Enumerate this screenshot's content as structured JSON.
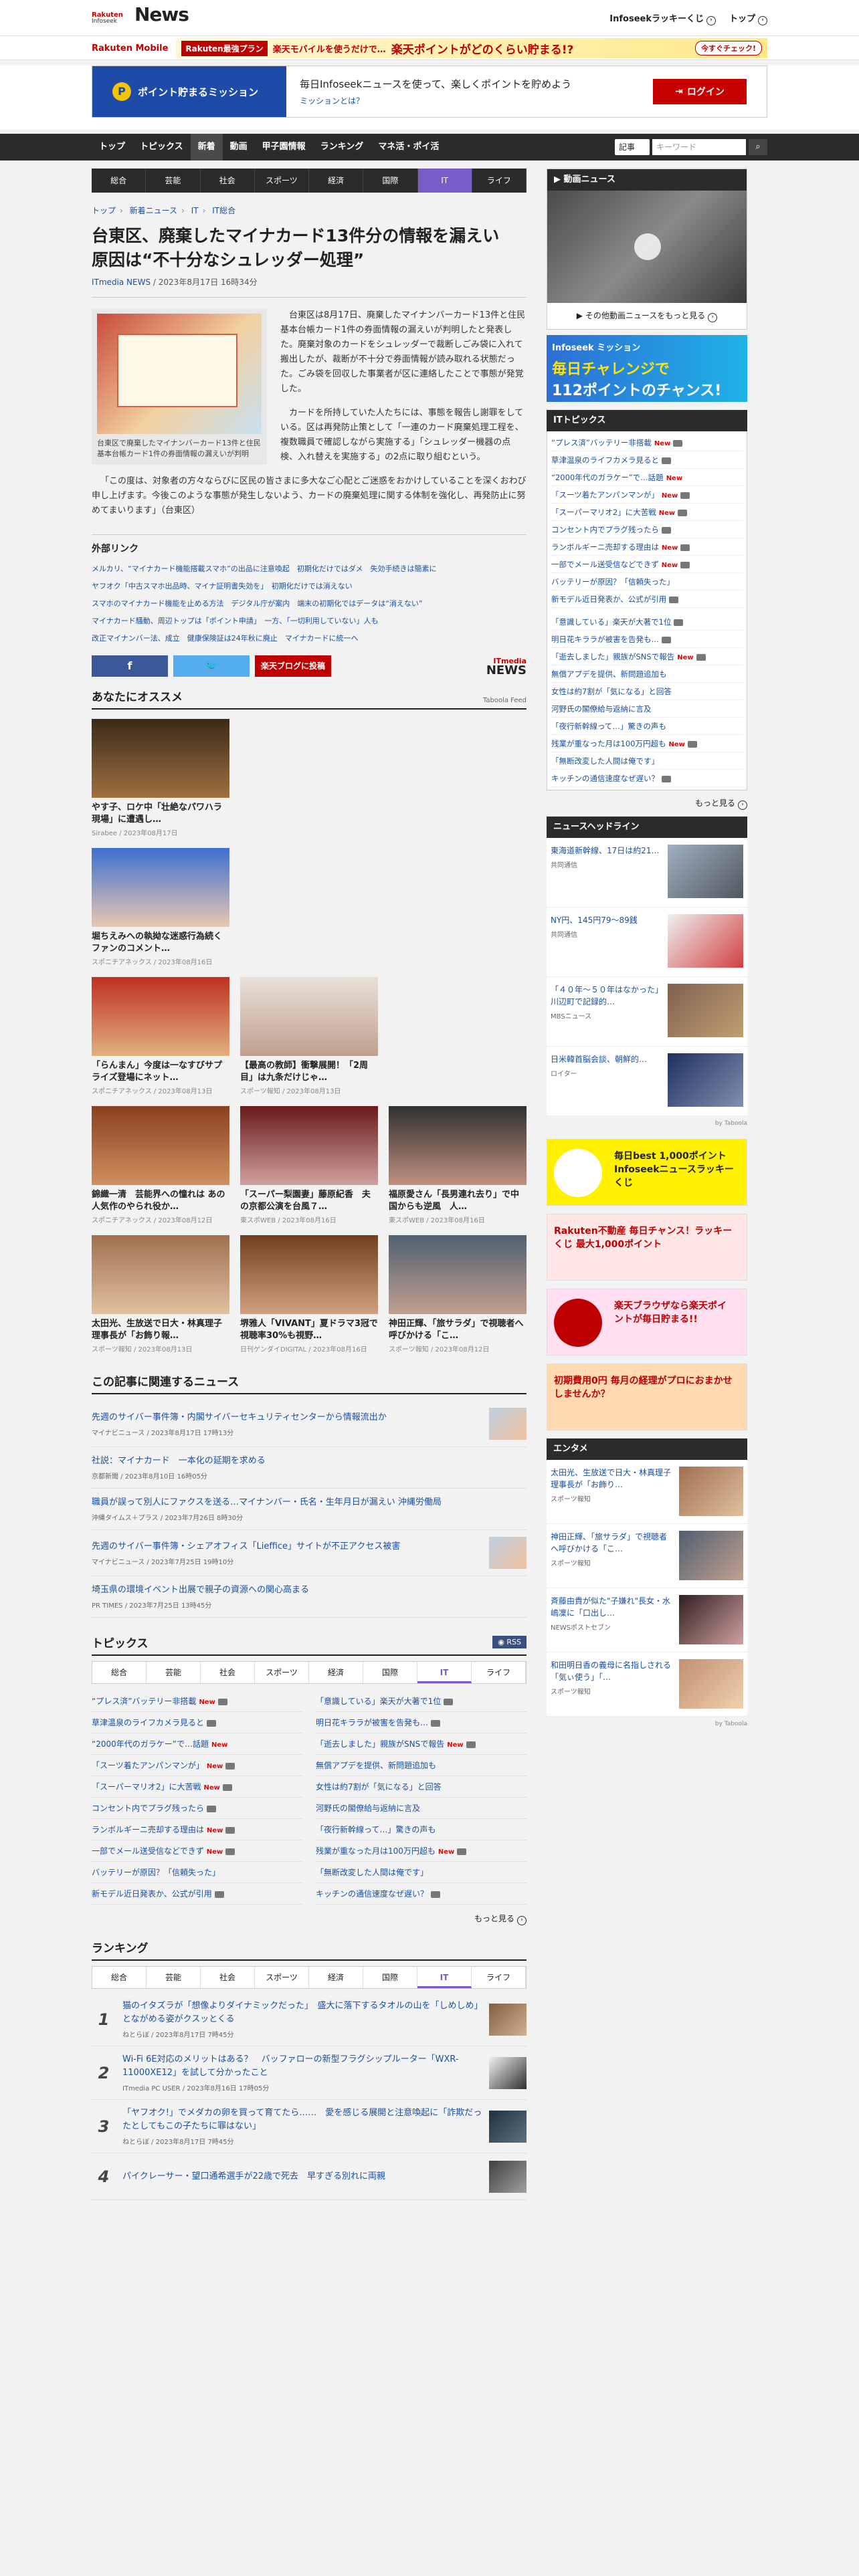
{
  "header": {
    "logo_top": "Rakuten",
    "logo_mid": "Infoseek",
    "logo_main": "News",
    "lucky_kuji": "Infoseekラッキーくじ",
    "top_link": "トップ"
  },
  "promo": {
    "mobile": "Rakuten Mobile",
    "tag": "Rakuten最強プラン",
    "text1": "楽天モバイルを使うだけで…",
    "text2": "楽天ポイントがどのくらい貯まる!?",
    "btn": "今すぐチェック!"
  },
  "mission": {
    "left": "ポイント貯まるミッション",
    "text": "毎日Infoseekニュースを使って、楽しくポイントを貯めよう",
    "sub": "ミッションとは？",
    "login": "ログイン"
  },
  "nav": {
    "items": [
      "トップ",
      "トピックス",
      "新着",
      "動画",
      "甲子園情報",
      "ランキング",
      "マネ活・ポイ活"
    ],
    "select": "記事",
    "search_placeholder": "キーワード"
  },
  "subnav": [
    "総合",
    "芸能",
    "社会",
    "スポーツ",
    "経済",
    "国際",
    "IT",
    "ライフ"
  ],
  "breadcrumb": [
    "トップ",
    "新着ニュース",
    "IT",
    "IT総合"
  ],
  "article": {
    "title": "台東区、廃棄したマイナカード13件分の情報を漏えい　原因は“不十分なシュレッダー処理”",
    "source": "ITmedia NEWS",
    "date": "2023年8月17日 16時34分",
    "caption": "台東区で廃棄したマイナンバーカード13件と住民基本台帳カード1件の券面情報の漏えいが判明",
    "p1": "台東区は8月17日、廃棄したマイナンバーカード13件と住民基本台帳カード1件の券面情報の漏えいが判明したと発表した。廃棄対象のカードをシュレッダーで裁断しごみ袋に入れて搬出したが、裁断が不十分で券面情報が読み取れる状態だった。ごみ袋を回収した事業者が区に連絡したことで事態が発覚した。",
    "p2": "カードを所持していた人たちには、事態を報告し謝罪をしている。区は再発防止策として「一連のカード廃棄処理工程を、複数職員で確認しながら実施する」「シュレッダー機器の点検、入れ替えを実施する」の2点に取り組むという。",
    "p3": "「この度は、対象者の方々ならびに区民の皆さまに多大なご心配とご迷惑をおかけしていることを深くおわび申し上げます。今後このような事態が発生しないよう、カードの廃棄処理に関する体制を強化し、再発防止に努めてまいります」（台東区）"
  },
  "external": {
    "title": "外部リンク",
    "links": [
      "メルカリ、“マイナカード機能搭載スマホ”の出品に注意喚起　初期化だけではダメ　失効手続きは簡素に",
      "ヤフオク「中古スマホ出品時、マイナ証明書失効を」　初期化だけでは消えない",
      "スマホのマイナカード機能を止める方法　デジタル庁が案内　端末の初期化ではデータは“消えない”",
      "マイナカード騒動、周辺トップは「ポイント申請」　一方、「一切利用していない」人も",
      "改正マイナンバー法、成立　健康保険証は24年秋に廃止　マイナカードに統一へ"
    ]
  },
  "share": {
    "fb": "f",
    "tw": "🐦",
    "blog": "楽天ブログに投稿",
    "logo1": "ITmedia",
    "logo2": "NEWS"
  },
  "recommend": {
    "title": "あなたにオススメ",
    "taboola": "Taboola Feed",
    "cards": [
      {
        "t": "やす子、ロケ中「壮絶なパワハラ現場」に遭遇し…",
        "s": "Sirabee / 2023年08月17日"
      },
      {
        "t": "堀ちえみへの執拗な迷惑行為続く　ファンのコメント…",
        "s": "スポニチアネックス / 2023年08月16日"
      },
      {
        "t": "「らんまん」今度は一なすびサプライズ登場にネット…",
        "s": "スポニチアネックス / 2023年08月13日"
      },
      {
        "t": "【最高の教師】衝撃展開！「2周目」は九条だけじゃ…",
        "s": "スポーツ報知 / 2023年08月13日"
      },
      {
        "t": "錦織一清　芸能界への憧れは あの人気作のやられ役か…",
        "s": "スポニチアネックス / 2023年08月12日"
      },
      {
        "t": "「スーパー梨園妻」藤原紀香　夫の京都公演を台風７…",
        "s": "東スポWEB / 2023年08月16日"
      },
      {
        "t": "福原愛さん「長男連れ去り」で中国からも逆風　人…",
        "s": "東スポWEB / 2023年08月16日"
      },
      {
        "t": "太田光、生放送で日大・林真理子理事長が「お飾り報…",
        "s": "スポーツ報知 / 2023年08月13日"
      },
      {
        "t": "堺雅人「VIVANT」夏ドラマ3冠で視聴率30%も視野…",
        "s": "日刊ゲンダイDIGITAL / 2023年08月16日"
      },
      {
        "t": "神田正輝、「旅サラダ」で視聴者へ呼びかける「こ…",
        "s": "スポーツ報知 / 2023年08月12日"
      }
    ]
  },
  "related": {
    "title": "この記事に関連するニュース",
    "items": [
      {
        "t": "先週のサイバー事件簿・内閣サイバーセキュリティセンターから情報流出か",
        "s": "マイナビニュース / 2023年8月17日 17時13分"
      },
      {
        "t": "社説：マイナカード　一本化の延期を求める",
        "s": "京都新聞 / 2023年8月10日 16時05分"
      },
      {
        "t": "職員が誤って別人にファクスを送る…マイナンバー・氏名・生年月日が漏えい 沖縄労働局",
        "s": "沖縄タイムス＋プラス / 2023年7月26日 8時30分"
      },
      {
        "t": "先週のサイバー事件簿・シェアオフィス「Lieffice」サイトが不正アクセス被害",
        "s": "マイナビニュース / 2023年7月25日 19時10分"
      },
      {
        "t": "埼玉県の環境イベント出展で親子の資源への関心高まる",
        "s": "PR TIMES / 2023年7月25日 13時45分"
      }
    ]
  },
  "topics": {
    "title": "トピックス",
    "rss": "RSS",
    "tabs": [
      "総合",
      "芸能",
      "社会",
      "スポーツ",
      "経済",
      "国際",
      "IT",
      "ライフ"
    ],
    "left": [
      "“プレス済”バッテリー非搭載",
      "草津温泉のライフカメラ見ると",
      "“2000年代のガラケー”で…話題",
      "「スーツ着たアンパンマンが」",
      "「スーパーマリオ2」に大苦戦",
      "コンセント内でプラグ残ったら",
      "ランボルギーニ売却する理由は",
      "一部でメール送受信などできず",
      "バッテリーが原因？「信頼失った」",
      "新モデル近日発表か、公式が引用"
    ],
    "right": [
      "「意識している」楽天が大著で1位",
      "明日花キララが被害を告発も…",
      "「逝去しました」親族がSNSで報告",
      "無償アプデを提供、新問題追加も",
      "女性は約7割が「気になる」と回答",
      "河野氏の閣僚給与返納に言及",
      "「夜行新幹線って…」驚きの声も",
      "残業が重なった月は100万円超も",
      "「無断改変した人間は俺です」",
      "キッチンの通信速度なぜ遅い？"
    ],
    "more": "もっと見る"
  },
  "ranking": {
    "title": "ランキング",
    "tabs": [
      "総合",
      "芸能",
      "社会",
      "スポーツ",
      "経済",
      "国際",
      "IT",
      "ライフ"
    ],
    "items": [
      {
        "n": "1",
        "t": "猫のイタズラが「想像よりダイナミックだった」　盛大に落下するタオルの山を「しめしめ」とながめる姿がクスッとくる",
        "s": "ねとらぼ / 2023年8月17日 7時45分"
      },
      {
        "n": "2",
        "t": "Wi-Fi 6E対応のメリットはある？　バッファローの新型フラグシップルーター「WXR-11000XE12」を試して分かったこと",
        "s": "ITmedia PC USER / 2023年8月16日 17時05分"
      },
      {
        "n": "3",
        "t": "「ヤフオク!」でメダカの卵を買って育てたら……　愛を感じる展開と注意喚起に「詐欺だったとしてもこの子たちに罪はない」",
        "s": "ねとらぼ / 2023年8月17日 7時45分"
      },
      {
        "n": "4",
        "t": "パイクレーサー・望口通希選手が22歳で死去　早すぎる別れに両親",
        "s": ""
      }
    ]
  },
  "side": {
    "video_title": "動画ニュース",
    "video_more": "その他動画ニュースをもっと見る",
    "banner1": "Infoseek ミッション",
    "banner2": "毎日チャレンジで",
    "banner3": "112ポイントのチャンス!",
    "it_title": "ITトピックス",
    "it_items": [
      "“プレス済”バッテリー非搭載",
      "草津温泉のライフカメラ見ると",
      "“2000年代のガラケー”で…話題",
      "「スーツ着たアンパンマンが」",
      "「スーパーマリオ2」に大苦戦",
      "コンセント内でプラグ残ったら",
      "ランボルギーニ売却する理由は",
      "一部でメール送受信などできず",
      "バッテリーが原因？「信頼失った」",
      "新モデル近日発表か、公式が引用",
      "「意識している」楽天が大著で1位",
      "明日花キララが被害を告発も…",
      "「逝去しました」親族がSNSで報告",
      "無償アプデを提供、新問題追加も",
      "女性は約7割が「気になる」と回答",
      "河野氏の閣僚給与返納に言及",
      "「夜行新幹線って…」驚きの声も",
      "残業が重なった月は100万円超も",
      "「無断改変した人間は俺です」",
      "キッチンの通信速度なぜ遅い？"
    ],
    "more": "もっと見る",
    "nh_title": "ニュースヘッドライン",
    "nh_items": [
      {
        "t": "東海道新幹線、17日は約21…",
        "s": "共同通信"
      },
      {
        "t": "NY円、145円79～89銭",
        "s": "共同通信"
      },
      {
        "t": "「４０年～５０年はなかった」川辺町で記録的…",
        "s": "MBSニュース"
      },
      {
        "t": "日米韓首脳会談、朝鮮的…",
        "s": "ロイター"
      }
    ],
    "taboola": "by Taboola",
    "ads": [
      "毎日best 1,000ポイント Infoseekニュースラッキーくじ",
      "Rakuten不動産 毎日チャンス！ラッキーくじ 最大1,000ポイント",
      "楽天ブラウザなら楽天ポイントが毎日貯まる!!",
      "初期費用0円 毎月の経理がプロにおまかせしませんか？"
    ],
    "ent_title": "エンタメ",
    "ent_items": [
      {
        "t": "太田光、生放送で日大・林真理子理事長が「お飾り…",
        "s": "スポーツ報知"
      },
      {
        "t": "神田正輝、「旅サラダ」で視聴者へ呼びかける「こ…",
        "s": "スポーツ報知"
      },
      {
        "t": "斉藤由貴が似た\"子嫌れ\"長女・水嶋凜に「口出し…",
        "s": "NEWSポストセブン"
      },
      {
        "t": "和田明日香の義母に名指しされる「気ぃ使う」「…",
        "s": "スポーツ報知"
      }
    ]
  }
}
